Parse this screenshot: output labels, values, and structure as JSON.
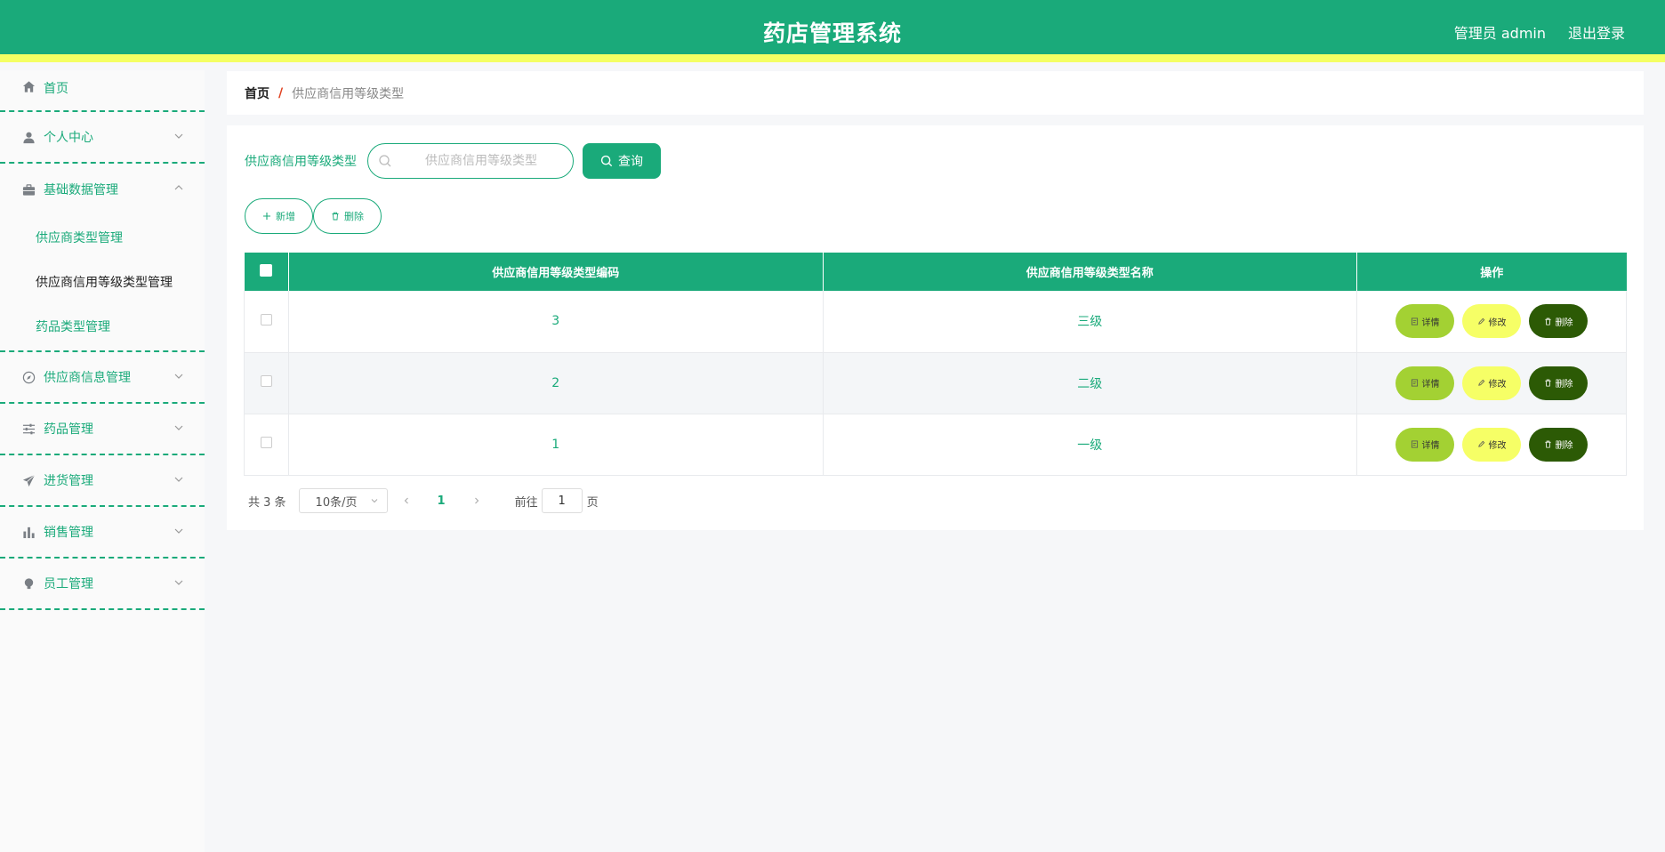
{
  "header": {
    "title": "药店管理系统",
    "user": "管理员 admin",
    "logout": "退出登录"
  },
  "sidebar": {
    "items": [
      {
        "label": "首页",
        "icon": "home-icon"
      },
      {
        "label": "个人中心",
        "icon": "user-icon"
      },
      {
        "label": "基础数据管理",
        "icon": "briefcase-icon",
        "expanded": true,
        "children": [
          "供应商类型管理",
          "供应商信用等级类型管理",
          "药品类型管理"
        ]
      },
      {
        "label": "供应商信息管理",
        "icon": "compass-icon"
      },
      {
        "label": "药品管理",
        "icon": "sliders-icon"
      },
      {
        "label": "进货管理",
        "icon": "send-icon"
      },
      {
        "label": "销售管理",
        "icon": "bar-chart-icon"
      },
      {
        "label": "员工管理",
        "icon": "lightbulb-icon"
      }
    ],
    "active_child": "供应商信用等级类型管理"
  },
  "breadcrumb": {
    "home": "首页",
    "separator": "/",
    "current": "供应商信用等级类型"
  },
  "search": {
    "label": "供应商信用等级类型",
    "placeholder": "供应商信用等级类型",
    "value": "",
    "button": "查询"
  },
  "actions": {
    "add": "新增",
    "delete": "删除"
  },
  "table": {
    "headers": [
      "供应商信用等级类型编码",
      "供应商信用等级类型名称",
      "操作"
    ],
    "rows": [
      {
        "code": "3",
        "name": "三级"
      },
      {
        "code": "2",
        "name": "二级"
      },
      {
        "code": "1",
        "name": "一级"
      }
    ],
    "ops": {
      "detail": "详情",
      "edit": "修改",
      "delete": "删除"
    }
  },
  "pagination": {
    "total": "共 3 条",
    "page_size": "10条/页",
    "current_page": "1",
    "goto_label": "前往",
    "goto_value": "1",
    "page_unit": "页"
  },
  "colors": {
    "primary": "#1aaa7a",
    "accent_stripe": "#f4ff63",
    "detail_btn": "#a3d133",
    "edit_btn": "#f6ff66",
    "delete_btn": "#2c5a05"
  }
}
